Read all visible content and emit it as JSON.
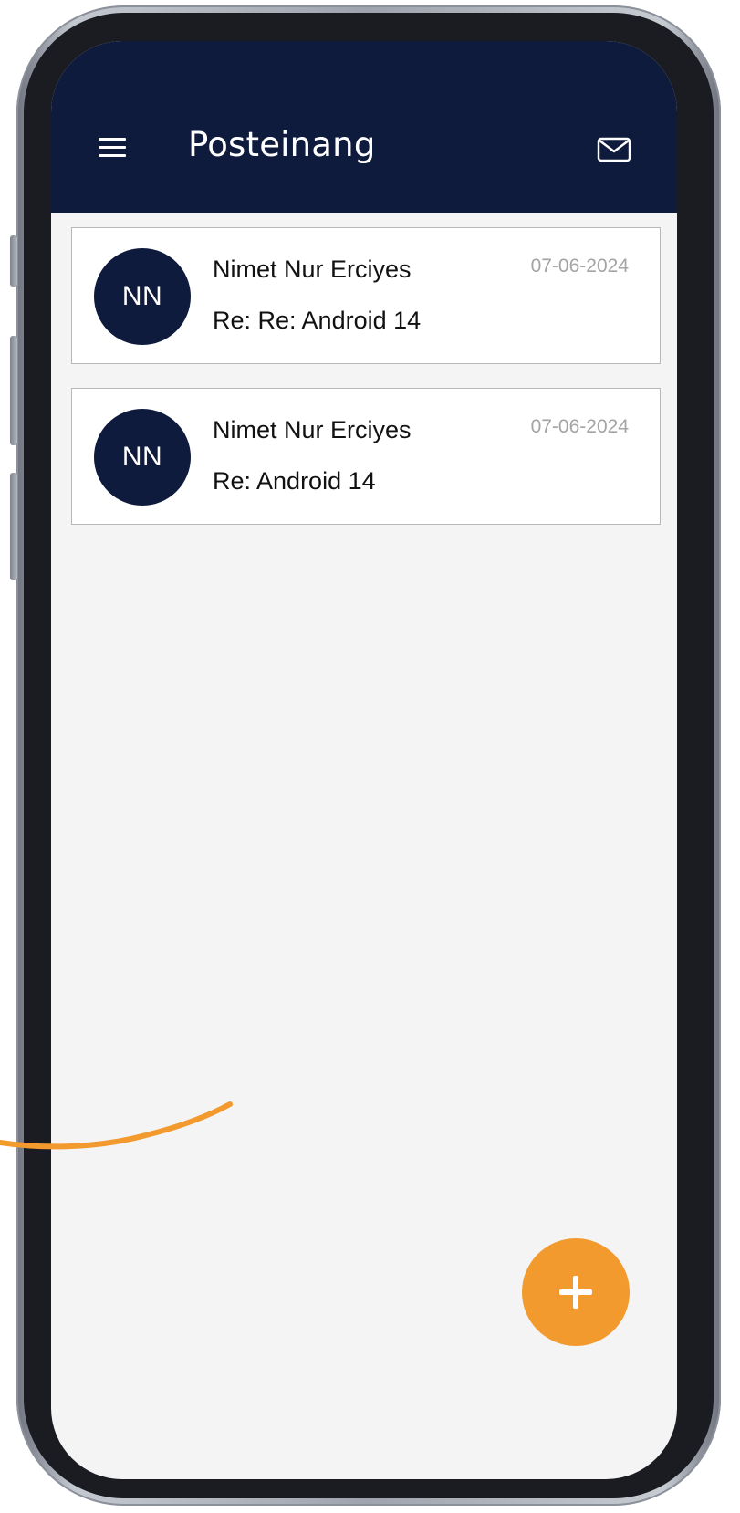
{
  "app_bar": {
    "title": "Posteinang",
    "menu_icon": "hamburger-menu-icon",
    "mail_icon": "envelope-icon",
    "background_color": "#0f1b3d"
  },
  "messages": [
    {
      "avatar_initials": "NN",
      "sender": "Nimet Nur Erciyes",
      "subject": "Re: Re: Android 14",
      "date": "07-06-2024"
    },
    {
      "avatar_initials": "NN",
      "sender": "Nimet Nur Erciyes",
      "subject": "Re: Android 14",
      "date": "07-06-2024"
    }
  ],
  "fab": {
    "icon": "plus-icon",
    "color": "#f29a2e"
  },
  "colors": {
    "accent": "#f29a2e",
    "primary": "#0f1b3d",
    "list_background": "#f4f4f4",
    "date_text": "#a4a4a4"
  }
}
